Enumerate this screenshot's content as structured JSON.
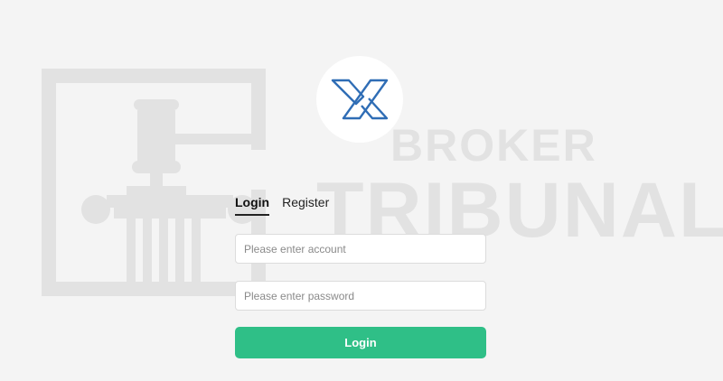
{
  "watermark": {
    "line1": "BROKER",
    "line2": "TRIBUNAL",
    "icon": "gavel-pillar-icon"
  },
  "logo": {
    "icon": "x-logo-icon",
    "color": "#2f6db5"
  },
  "tabs": [
    {
      "label": "Login",
      "active": true
    },
    {
      "label": "Register",
      "active": false
    }
  ],
  "form": {
    "account_placeholder": "Please enter account",
    "password_placeholder": "Please enter password",
    "submit_label": "Login"
  },
  "colors": {
    "background": "#f4f4f4",
    "accent": "#2fbf87",
    "watermark": "#e2e2e2"
  }
}
